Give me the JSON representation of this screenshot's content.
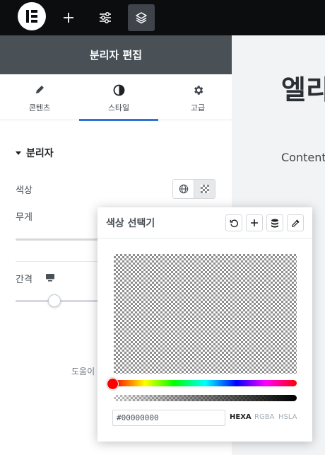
{
  "panel": {
    "title": "분리자 편집",
    "tabs": [
      {
        "label": "콘텐츠",
        "icon": "pencil-icon"
      },
      {
        "label": "스타일",
        "icon": "contrast-icon",
        "active": true
      },
      {
        "label": "고급",
        "icon": "gear-icon"
      }
    ],
    "section": {
      "title": "분리자"
    },
    "controls": {
      "color_label": "색상",
      "weight_label": "무게",
      "gap_label": "간격"
    },
    "help_text": "도움이"
  },
  "preview": {
    "heading": "엘리",
    "text": "Content"
  },
  "color_picker": {
    "title": "색상 선택기",
    "hex_value": "#00000000",
    "formats": [
      "HEXA",
      "RGBA",
      "HSLA"
    ],
    "active_format": "HEXA",
    "hue_color": "#ff0000"
  },
  "colors": {
    "topbar_bg": "#0c0d0e",
    "panel_header_bg": "#495157",
    "accent": "#2f73d3"
  }
}
